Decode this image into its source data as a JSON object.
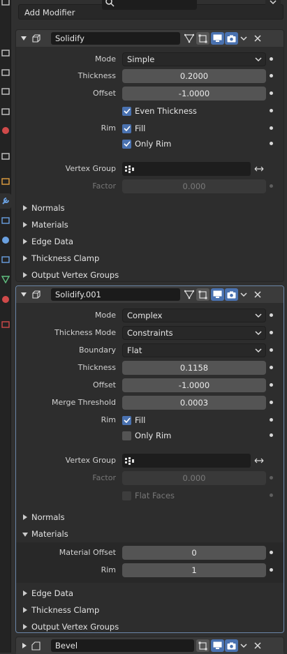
{
  "top": {
    "add_modifier": "Add Modifier"
  },
  "tabs": [
    "tool-tab",
    "render-tab",
    "output-tab",
    "view-layer-tab",
    "scene-tab",
    "world-tab",
    "collection-tab",
    "object-tab",
    "modifier-tab",
    "particles-tab",
    "physics-tab",
    "constraints-tab",
    "data-tab",
    "material-tab",
    "texture-tab"
  ],
  "m1": {
    "name": "Solidify",
    "mode_label": "Mode",
    "mode": "Simple",
    "thickness_label": "Thickness",
    "thickness": "0.2000",
    "offset_label": "Offset",
    "offset": "-1.0000",
    "even_thickness": "Even Thickness",
    "rim_label": "Rim",
    "fill": "Fill",
    "only_rim": "Only Rim",
    "vgroup_label": "Vertex Group",
    "factor_label": "Factor",
    "factor": "0.000",
    "subpanels": [
      "Normals",
      "Materials",
      "Edge Data",
      "Thickness Clamp",
      "Output Vertex Groups"
    ]
  },
  "m2": {
    "name": "Solidify.001",
    "mode_label": "Mode",
    "mode": "Complex",
    "tmode_label": "Thickness Mode",
    "tmode": "Constraints",
    "boundary_label": "Boundary",
    "boundary": "Flat",
    "thickness_label": "Thickness",
    "thickness": "0.1158",
    "offset_label": "Offset",
    "offset": "-1.0000",
    "merge_label": "Merge Threshold",
    "merge": "0.0003",
    "rim_label": "Rim",
    "fill": "Fill",
    "only_rim": "Only Rim",
    "vgroup_label": "Vertex Group",
    "factor_label": "Factor",
    "factor": "0.000",
    "flat_faces": "Flat Faces",
    "normals": "Normals",
    "materials": "Materials",
    "mat_offset_label": "Material Offset",
    "mat_offset": "0",
    "mat_rim_label": "Rim",
    "mat_rim": "1",
    "edge_data": "Edge Data",
    "thickness_clamp": "Thickness Clamp",
    "output_vg": "Output Vertex Groups"
  },
  "m3": {
    "name": "Bevel"
  },
  "colors": {
    "accent": "#4a72b0",
    "active_border": "#6b86a8",
    "panel": "#2d2d2d",
    "header": "#3b3b3b"
  }
}
